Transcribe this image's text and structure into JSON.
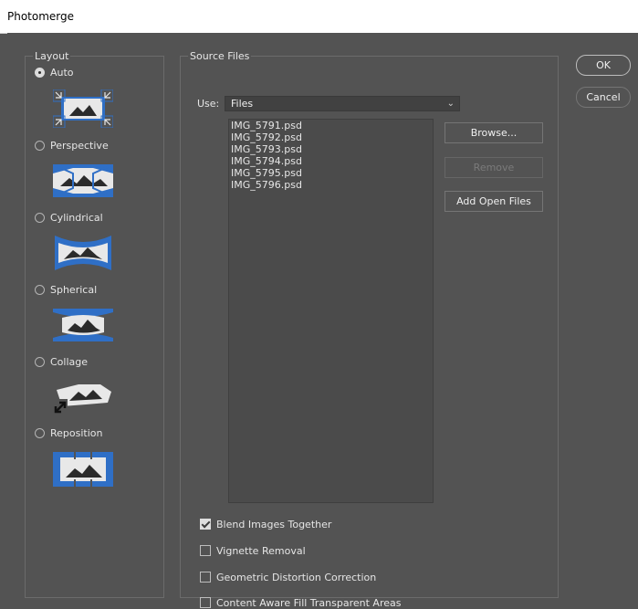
{
  "window": {
    "title": "Photomerge"
  },
  "layout_group": {
    "legend": "Layout",
    "options": [
      {
        "label": "Auto",
        "selected": true,
        "icon": "auto-layout-icon"
      },
      {
        "label": "Perspective",
        "selected": false,
        "icon": "perspective-layout-icon"
      },
      {
        "label": "Cylindrical",
        "selected": false,
        "icon": "cylindrical-layout-icon"
      },
      {
        "label": "Spherical",
        "selected": false,
        "icon": "spherical-layout-icon"
      },
      {
        "label": "Collage",
        "selected": false,
        "icon": "collage-layout-icon"
      },
      {
        "label": "Reposition",
        "selected": false,
        "icon": "reposition-layout-icon"
      }
    ]
  },
  "source_group": {
    "legend": "Source Files",
    "use_label": "Use:",
    "use_value": "Files",
    "files": [
      "IMG_5791.psd",
      "IMG_5792.psd",
      "IMG_5793.psd",
      "IMG_5794.psd",
      "IMG_5795.psd",
      "IMG_5796.psd"
    ],
    "browse": "Browse...",
    "remove": "Remove",
    "add_open": "Add Open Files",
    "options": [
      {
        "label": "Blend Images Together",
        "checked": true
      },
      {
        "label": "Vignette Removal",
        "checked": false
      },
      {
        "label": "Geometric Distortion Correction",
        "checked": false
      },
      {
        "label": "Content Aware Fill Transparent Areas",
        "checked": false
      }
    ]
  },
  "actions": {
    "ok": "OK",
    "cancel": "Cancel"
  },
  "colors": {
    "accent_blue": "#2f6fc6",
    "panel": "#535353",
    "icon_white": "#e8e8e8"
  }
}
